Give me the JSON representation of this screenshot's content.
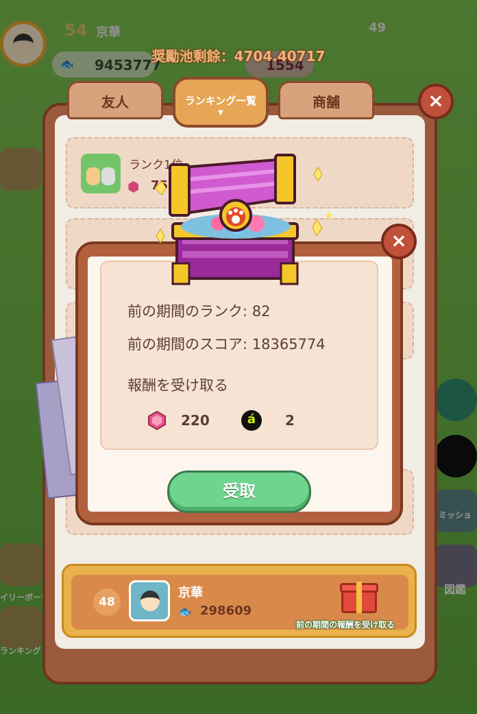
{
  "hud": {
    "level": "54",
    "name": "京華",
    "coins": "9453777",
    "gems": "1554",
    "top_count": "49"
  },
  "pool_text": "奨勵池剩餘：4704.40717",
  "tabs": {
    "friends": "友人",
    "ranking": "ランキング一覧",
    "shop": "商舗"
  },
  "rank_row_1": {
    "title": "ランク1位",
    "value_partial": "75"
  },
  "side": {
    "left_bonus": "イリーボーナ",
    "left_ranking": "ランキング",
    "right_mission": "ミッショ",
    "right_book": "図鑑"
  },
  "dialog": {
    "prev_rank_label": "前の期間のランク: 82",
    "prev_score_label": "前の期間のスコア: 18365774",
    "receive_label": "報酬を受け取る",
    "reward_gems": "220",
    "reward_coin_glyph": "á",
    "reward_coins": "2",
    "claim_button": "受取",
    "close": "×"
  },
  "my_row": {
    "rank": "48",
    "name": "京華",
    "score": "298609",
    "gift_label": "前の期間の報酬を受け取る"
  },
  "colors": {
    "panel": "#9c5a3c",
    "claim_button": "#6fd48e",
    "gem": "#d0467a",
    "gift": "#e04a3a"
  }
}
